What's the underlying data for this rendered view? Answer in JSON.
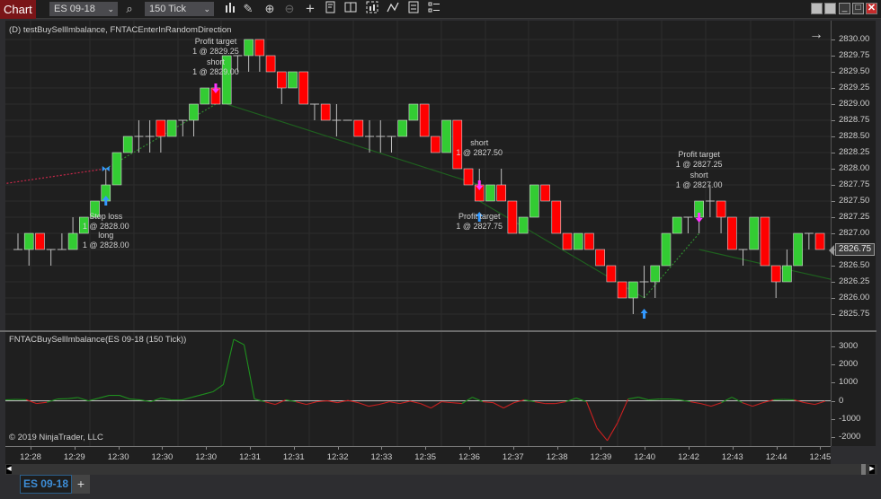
{
  "toolbar": {
    "chart_tab": "Chart",
    "instrument": "ES 09-18",
    "interval": "150 Tick",
    "icons": [
      "bar-type-icon",
      "drawing-tool-icon",
      "zoom-in-icon",
      "zoom-out-icon",
      "crosshair-icon",
      "strategy-icon",
      "data-box-icon",
      "chart-trader-icon",
      "indicators-icon",
      "properties-icon",
      "templates-icon"
    ],
    "window_buttons": [
      "button-1",
      "button-2",
      "minimize",
      "maximize",
      "close"
    ]
  },
  "price_panel": {
    "title": "(D) testBuySellImbalance, FNTACEnterInRandomDirection",
    "current_price": "2826.75",
    "axis_labels": [
      "2830.00",
      "2829.75",
      "2829.50",
      "2829.25",
      "2829.00",
      "2828.75",
      "2828.50",
      "2828.25",
      "2828.00",
      "2827.75",
      "2827.50",
      "2827.25",
      "2827.00",
      "2826.75",
      "2826.50",
      "2826.25",
      "2826.00",
      "2825.75"
    ]
  },
  "indicator_panel": {
    "title": "FNTACBuySellImbalance(ES 09-18 (150 Tick))",
    "axis_labels": [
      "3000",
      "2000",
      "1000",
      "0",
      "-1000",
      "-2000"
    ],
    "copyright": "© 2019 NinjaTrader, LLC"
  },
  "time_axis": {
    "labels": [
      "12:28",
      "12:29",
      "12:30",
      "12:30",
      "12:30",
      "12:31",
      "12:31",
      "12:32",
      "12:33",
      "12:35",
      "12:36",
      "12:37",
      "12:38",
      "12:39",
      "12:40",
      "12:42",
      "12:43",
      "12:44",
      "12:45"
    ]
  },
  "annotations": [
    {
      "lines": [
        "Stop loss",
        "1 @ 2828.00"
      ],
      "anchor": "below",
      "idx": 8
    },
    {
      "lines": [
        "long",
        "1 @ 2828.00"
      ],
      "anchor": "below2",
      "idx": 8
    },
    {
      "lines": [
        "Profit target",
        "1 @ 2829.25"
      ],
      "anchor": "above2",
      "idx": 18
    },
    {
      "lines": [
        "short",
        "1 @ 2829.00"
      ],
      "anchor": "above",
      "idx": 18
    },
    {
      "lines": [
        "short",
        "1 @ 2827.50"
      ],
      "anchor": "above",
      "idx": 42
    },
    {
      "lines": [
        "Profit target",
        "1 @ 2827.75"
      ],
      "anchor": "below",
      "idx": 42
    },
    {
      "lines": [
        "Profit target",
        "1 @ 2827.25"
      ],
      "anchor": "above2",
      "idx": 62
    },
    {
      "lines": [
        "short",
        "1 @ 2827.00"
      ],
      "anchor": "above",
      "idx": 62
    }
  ],
  "bottom_tabs": {
    "active": "ES 09-18",
    "add_label": "+"
  },
  "chart_data": [
    {
      "type": "candlestick",
      "title": "(D) testBuySellImbalance, FNTACEnterInRandomDirection",
      "ylim": [
        2825.625,
        2830.125
      ],
      "tick_size": 0.25,
      "colors": {
        "up": "#33cc33",
        "down": "#ff0000",
        "doji": "#cfcfcf"
      },
      "candles": [
        {
          "o": 2826.75,
          "h": 2827.0,
          "l": 2826.75,
          "c": 2826.75
        },
        {
          "o": 2826.75,
          "h": 2827.0,
          "l": 2826.5,
          "c": 2827.0
        },
        {
          "o": 2827.0,
          "h": 2827.0,
          "l": 2826.75,
          "c": 2826.75
        },
        {
          "o": 2826.75,
          "h": 2826.75,
          "l": 2826.5,
          "c": 2826.75
        },
        {
          "o": 2826.75,
          "h": 2827.0,
          "l": 2826.75,
          "c": 2826.75
        },
        {
          "o": 2826.75,
          "h": 2827.25,
          "l": 2826.75,
          "c": 2827.0
        },
        {
          "o": 2827.0,
          "h": 2827.25,
          "l": 2827.0,
          "c": 2827.25
        },
        {
          "o": 2827.25,
          "h": 2827.5,
          "l": 2827.25,
          "c": 2827.5
        },
        {
          "o": 2827.5,
          "h": 2828.0,
          "l": 2827.5,
          "c": 2827.75
        },
        {
          "o": 2827.75,
          "h": 2828.25,
          "l": 2827.75,
          "c": 2828.25
        },
        {
          "o": 2828.25,
          "h": 2828.5,
          "l": 2828.25,
          "c": 2828.5
        },
        {
          "o": 2828.5,
          "h": 2828.75,
          "l": 2828.25,
          "c": 2828.5
        },
        {
          "o": 2828.5,
          "h": 2828.75,
          "l": 2828.25,
          "c": 2828.5
        },
        {
          "o": 2828.75,
          "h": 2828.75,
          "l": 2828.25,
          "c": 2828.5
        },
        {
          "o": 2828.5,
          "h": 2828.75,
          "l": 2828.5,
          "c": 2828.75
        },
        {
          "o": 2828.75,
          "h": 2828.75,
          "l": 2828.5,
          "c": 2828.75
        },
        {
          "o": 2828.75,
          "h": 2829.0,
          "l": 2828.5,
          "c": 2829.0
        },
        {
          "o": 2829.0,
          "h": 2829.25,
          "l": 2829.0,
          "c": 2829.25
        },
        {
          "o": 2829.25,
          "h": 2829.25,
          "l": 2829.0,
          "c": 2829.0
        },
        {
          "o": 2829.0,
          "h": 2829.75,
          "l": 2829.0,
          "c": 2829.75
        },
        {
          "o": 2829.75,
          "h": 2829.75,
          "l": 2829.5,
          "c": 2829.75
        },
        {
          "o": 2829.75,
          "h": 2830.0,
          "l": 2829.5,
          "c": 2830.0
        },
        {
          "o": 2830.0,
          "h": 2830.0,
          "l": 2829.5,
          "c": 2829.75
        },
        {
          "o": 2829.75,
          "h": 2829.75,
          "l": 2829.5,
          "c": 2829.5
        },
        {
          "o": 2829.5,
          "h": 2829.5,
          "l": 2829.0,
          "c": 2829.25
        },
        {
          "o": 2829.25,
          "h": 2829.5,
          "l": 2829.25,
          "c": 2829.5
        },
        {
          "o": 2829.5,
          "h": 2829.5,
          "l": 2829.0,
          "c": 2829.0
        },
        {
          "o": 2829.0,
          "h": 2829.0,
          "l": 2828.75,
          "c": 2829.0
        },
        {
          "o": 2829.0,
          "h": 2829.0,
          "l": 2828.75,
          "c": 2828.75
        },
        {
          "o": 2828.75,
          "h": 2829.0,
          "l": 2828.5,
          "c": 2828.75
        },
        {
          "o": 2828.75,
          "h": 2828.75,
          "l": 2828.75,
          "c": 2828.75
        },
        {
          "o": 2828.75,
          "h": 2828.75,
          "l": 2828.5,
          "c": 2828.5
        },
        {
          "o": 2828.5,
          "h": 2828.75,
          "l": 2828.25,
          "c": 2828.5
        },
        {
          "o": 2828.5,
          "h": 2828.75,
          "l": 2828.25,
          "c": 2828.5
        },
        {
          "o": 2828.5,
          "h": 2828.5,
          "l": 2828.25,
          "c": 2828.5
        },
        {
          "o": 2828.5,
          "h": 2828.75,
          "l": 2828.5,
          "c": 2828.75
        },
        {
          "o": 2828.75,
          "h": 2829.0,
          "l": 2828.75,
          "c": 2829.0
        },
        {
          "o": 2829.0,
          "h": 2829.0,
          "l": 2828.5,
          "c": 2828.5
        },
        {
          "o": 2828.5,
          "h": 2828.5,
          "l": 2828.25,
          "c": 2828.25
        },
        {
          "o": 2828.25,
          "h": 2828.75,
          "l": 2828.25,
          "c": 2828.75
        },
        {
          "o": 2828.75,
          "h": 2828.75,
          "l": 2828.0,
          "c": 2828.0
        },
        {
          "o": 2828.0,
          "h": 2828.0,
          "l": 2827.75,
          "c": 2827.75
        },
        {
          "o": 2827.75,
          "h": 2828.0,
          "l": 2827.5,
          "c": 2827.5
        },
        {
          "o": 2827.5,
          "h": 2827.75,
          "l": 2827.5,
          "c": 2827.75
        },
        {
          "o": 2827.75,
          "h": 2828.0,
          "l": 2827.5,
          "c": 2827.5
        },
        {
          "o": 2827.5,
          "h": 2827.5,
          "l": 2827.0,
          "c": 2827.0
        },
        {
          "o": 2827.0,
          "h": 2827.25,
          "l": 2827.0,
          "c": 2827.25
        },
        {
          "o": 2827.25,
          "h": 2827.75,
          "l": 2827.25,
          "c": 2827.75
        },
        {
          "o": 2827.75,
          "h": 2827.75,
          "l": 2827.5,
          "c": 2827.5
        },
        {
          "o": 2827.5,
          "h": 2827.5,
          "l": 2827.0,
          "c": 2827.0
        },
        {
          "o": 2827.0,
          "h": 2827.0,
          "l": 2826.75,
          "c": 2826.75
        },
        {
          "o": 2826.75,
          "h": 2827.0,
          "l": 2826.75,
          "c": 2827.0
        },
        {
          "o": 2827.0,
          "h": 2827.0,
          "l": 2826.75,
          "c": 2826.75
        },
        {
          "o": 2826.75,
          "h": 2826.75,
          "l": 2826.5,
          "c": 2826.5
        },
        {
          "o": 2826.5,
          "h": 2826.5,
          "l": 2826.25,
          "c": 2826.25
        },
        {
          "o": 2826.25,
          "h": 2826.25,
          "l": 2826.0,
          "c": 2826.0
        },
        {
          "o": 2826.0,
          "h": 2826.25,
          "l": 2825.75,
          "c": 2826.25
        },
        {
          "o": 2826.25,
          "h": 2826.5,
          "l": 2826.0,
          "c": 2826.25
        },
        {
          "o": 2826.25,
          "h": 2826.5,
          "l": 2826.0,
          "c": 2826.5
        },
        {
          "o": 2826.5,
          "h": 2827.0,
          "l": 2826.5,
          "c": 2827.0
        },
        {
          "o": 2827.0,
          "h": 2827.25,
          "l": 2827.0,
          "c": 2827.25
        },
        {
          "o": 2827.25,
          "h": 2827.25,
          "l": 2827.0,
          "c": 2827.25
        },
        {
          "o": 2827.25,
          "h": 2827.5,
          "l": 2827.0,
          "c": 2827.5
        },
        {
          "o": 2827.5,
          "h": 2827.75,
          "l": 2827.25,
          "c": 2827.5
        },
        {
          "o": 2827.5,
          "h": 2827.5,
          "l": 2827.0,
          "c": 2827.25
        },
        {
          "o": 2827.25,
          "h": 2827.25,
          "l": 2826.75,
          "c": 2826.75
        },
        {
          "o": 2826.75,
          "h": 2826.75,
          "l": 2826.5,
          "c": 2826.75
        },
        {
          "o": 2826.75,
          "h": 2827.25,
          "l": 2826.75,
          "c": 2827.25
        },
        {
          "o": 2827.25,
          "h": 2827.25,
          "l": 2826.5,
          "c": 2826.5
        },
        {
          "o": 2826.5,
          "h": 2826.5,
          "l": 2826.0,
          "c": 2826.25
        },
        {
          "o": 2826.25,
          "h": 2826.75,
          "l": 2826.25,
          "c": 2826.5
        },
        {
          "o": 2826.5,
          "h": 2827.0,
          "l": 2826.5,
          "c": 2827.0
        },
        {
          "o": 2827.0,
          "h": 2827.0,
          "l": 2826.75,
          "c": 2827.0
        },
        {
          "o": 2827.0,
          "h": 2827.0,
          "l": 2826.75,
          "c": 2826.75
        }
      ],
      "trade_lines": [
        {
          "from_idx": -2,
          "from_price": 2827.75,
          "to_idx": 8,
          "to_price": 2828.0,
          "color": "#c8284a",
          "style": "dotted"
        },
        {
          "from_idx": 8,
          "from_price": 2828.0,
          "to_idx": 18,
          "to_price": 2829.0,
          "color": "#2e8b2e",
          "style": "dotted"
        },
        {
          "from_idx": 19,
          "from_price": 2829.0,
          "to_idx": 42,
          "to_price": 2827.75,
          "color": "#1f5f1f",
          "style": "solid"
        },
        {
          "from_idx": 42,
          "from_price": 2827.5,
          "to_idx": 57,
          "to_price": 2826.0,
          "color": "#1f5f1f",
          "style": "solid"
        },
        {
          "from_idx": 57,
          "from_price": 2826.0,
          "to_idx": 62,
          "to_price": 2827.0,
          "color": "#2e8b2e",
          "style": "dotted"
        },
        {
          "from_idx": 62,
          "from_price": 2826.75,
          "to_idx": 75,
          "to_price": 2826.25,
          "color": "#1f5f1f",
          "style": "solid"
        }
      ],
      "markers": [
        {
          "idx": 8,
          "type": "buy-arrow",
          "price": 2827.5,
          "color": "#3399ff"
        },
        {
          "idx": 8,
          "type": "stop-marker",
          "price": 2828.0,
          "color": "#3399ff"
        },
        {
          "idx": 18,
          "type": "sell-arrow",
          "price": 2829.25,
          "color": "#ff33ff"
        },
        {
          "idx": 42,
          "type": "sell-arrow",
          "price": 2827.75,
          "color": "#ff33ff"
        },
        {
          "idx": 42,
          "type": "buy-arrow",
          "price": 2827.25,
          "color": "#3399ff"
        },
        {
          "idx": 57,
          "type": "buy-arrow",
          "price": 2825.75,
          "color": "#3399ff"
        },
        {
          "idx": 62,
          "type": "sell-arrow",
          "price": 2827.25,
          "color": "#ff33ff"
        }
      ]
    },
    {
      "type": "line",
      "title": "FNTACBuySellImbalance(ES 09-18 (150 Tick))",
      "ylim": [
        -2500,
        3800
      ],
      "zero_line_color": "#c8c8c8",
      "colors": {
        "positive": "#1f8f1f",
        "negative": "#cc2020"
      },
      "values": [
        50,
        80,
        60,
        -150,
        -80,
        100,
        120,
        180,
        0,
        150,
        300,
        300,
        100,
        50,
        -50,
        150,
        50,
        50,
        200,
        350,
        500,
        900,
        3400,
        3100,
        100,
        -50,
        -200,
        50,
        -50,
        -200,
        -50,
        0,
        -100,
        20,
        -100,
        -300,
        -200,
        -50,
        -150,
        -20,
        -150,
        -400,
        -50,
        -100,
        -150,
        200,
        -50,
        -100,
        -400,
        -100,
        50,
        -50,
        -150,
        -150,
        -50,
        150,
        -50,
        -1500,
        -2200,
        -1200,
        100,
        200,
        50,
        100,
        100,
        50,
        -50,
        -150,
        -300,
        -100,
        200,
        -100,
        -300,
        -100,
        50,
        80,
        50,
        -100,
        -200,
        -20
      ]
    }
  ]
}
